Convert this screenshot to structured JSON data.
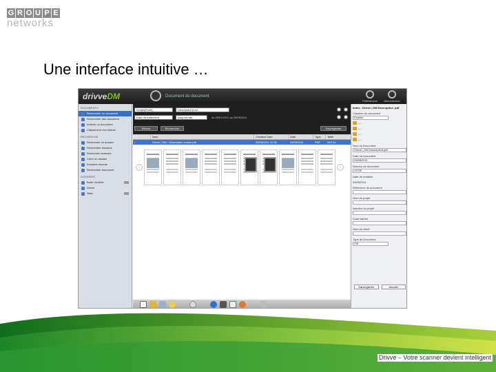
{
  "logo": {
    "top_letters": [
      "G",
      "R",
      "O",
      "U",
      "P",
      "E"
    ],
    "bottom": "networks"
  },
  "slide": {
    "title": "Une interface intuitive …",
    "footer": "Drivve – Votre scanner devient intelligent"
  },
  "app": {
    "brand": {
      "name": "drivve",
      "suffix": "DM"
    },
    "doc_title": "Document du document",
    "header_buttons": [
      {
        "label": "Préférences",
        "icon": "gear-icon"
      },
      {
        "label": "Déconnexion",
        "icon": "power-icon"
      }
    ],
    "sidebar": {
      "sections": [
        {
          "title": "DOCUMENTS",
          "items": [
            {
              "label": "Rechercher un document",
              "active": true
            },
            {
              "label": "Rechercher des document",
              "active": false
            },
            {
              "label": "Indexer un document",
              "active": false
            },
            {
              "label": "Classement non indexé",
              "active": false
            }
          ]
        },
        {
          "title": "RECHERCHE",
          "items": [
            {
              "label": "Recherche un dossier",
              "active": false
            },
            {
              "label": "Rechercher dossiers",
              "active": false
            },
            {
              "label": "Recherche avancée",
              "active": false
            },
            {
              "label": "Créer un dossier",
              "active": false
            },
            {
              "label": "Dossiers récents",
              "active": false
            },
            {
              "label": "Rechercher document",
              "active": false
            }
          ]
        },
        {
          "title": "DOSSIERS",
          "items": [
            {
              "label": "Boîte d'entrée",
              "active": false
            },
            {
              "label": "Drivve",
              "active": false
            },
            {
              "label": "Sites",
              "active": false
            }
          ]
        }
      ]
    },
    "search": {
      "row1": {
        "field": "Scripts(Éveil)",
        "value": "Description pour"
      },
      "row2": {
        "field": "Date du traitement",
        "operator": "jusqu'au fait",
        "range": "du 29/01/2011 au 29/05/2011"
      },
      "buttons": {
        "search": "Effacer",
        "reset": "Rechercher",
        "save": "Sauvegarder"
      }
    },
    "results": {
      "columns": [
        "Nom",
        "Création Date",
        "Date",
        "Type",
        "Taille"
      ],
      "rows": [
        {
          "name": "Drivve | DM - Description voulue.pdf",
          "created": "29/05/2011 12:30",
          "date": "29/05/2011",
          "type": "PDF",
          "size": "393 Ko"
        }
      ]
    },
    "properties": {
      "title": "Index : Drivve | DM Description .pdf",
      "doc_type_label": "Classeur du document",
      "doc_type_value": "Dossier",
      "folders": [
        "---",
        "---",
        "---",
        "---"
      ],
      "fields": [
        {
          "label": "Nom du Document",
          "value": "Drivve | DM Description.pdf"
        },
        {
          "label": "Date du Document",
          "value": "29/05/2011"
        },
        {
          "label": "Numéro de document",
          "value": "12700"
        },
        {
          "label": "Date de création",
          "value": "29/05/2011"
        },
        {
          "label": "Référence du document",
          "value": ""
        },
        {
          "label": "Nom du projet",
          "value": ""
        },
        {
          "label": "Numéro du projet",
          "value": ""
        },
        {
          "label": "Code barres",
          "value": ""
        },
        {
          "label": "Nom du client",
          "value": ""
        },
        {
          "label": "Type de Document",
          "value": "Pdf"
        }
      ],
      "buttons": {
        "save": "Sauvegarder",
        "cancel": "Annuler"
      }
    },
    "toolbar_icons": [
      "page-icon",
      "edit-icon",
      "layers-icon",
      "stamp-icon",
      "split-icon",
      "download-icon",
      "print-icon",
      "mail-icon",
      "export-icon",
      "trash-icon"
    ]
  }
}
